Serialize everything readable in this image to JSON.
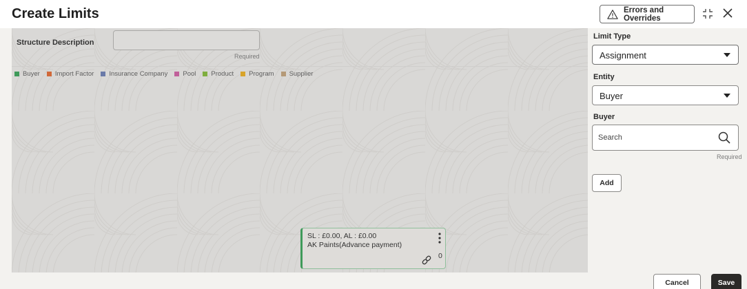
{
  "header": {
    "title": "Create Limits",
    "errors_button_label": "Errors and Overrides",
    "warning_icon": "warning-triangle-icon",
    "compress_icon": "compress-icon",
    "close_icon": "close-icon"
  },
  "canvas": {
    "structure_description_label": "Structure Description",
    "structure_description_value": "",
    "structure_description_required": "Required",
    "legend": [
      {
        "label": "Buyer",
        "color": "#3f9a5a"
      },
      {
        "label": "Import Factor",
        "color": "#d0693a"
      },
      {
        "label": "Insurance Company",
        "color": "#6a7aa8"
      },
      {
        "label": "Pool",
        "color": "#c0609a"
      },
      {
        "label": "Product",
        "color": "#7fae3f"
      },
      {
        "label": "Program",
        "color": "#d8a42a"
      },
      {
        "label": "Supplier",
        "color": "#b59a78"
      }
    ],
    "node": {
      "line1": "SL : £0.00, AL : £0.00",
      "line2": "AK Paints(Advance payment)",
      "link_count": "0",
      "kebab_icon": "more-vertical-icon",
      "link_icon": "link-icon"
    }
  },
  "panel": {
    "limit_type_label": "Limit Type",
    "limit_type_value": "Assignment",
    "entity_label": "Entity",
    "entity_value": "Buyer",
    "buyer_label": "Buyer",
    "buyer_placeholder": "Search",
    "buyer_required": "Required",
    "add_label": "Add"
  },
  "footer": {
    "cancel_label": "Cancel",
    "save_label": "Save"
  }
}
